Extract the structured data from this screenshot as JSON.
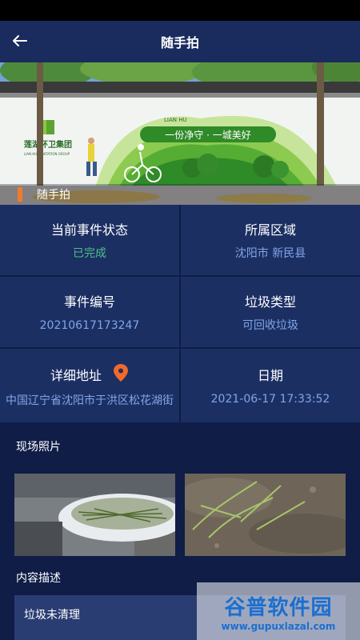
{
  "header": {
    "title": "随手拍"
  },
  "banner": {
    "slogan": "一份净守 · 一城美好",
    "company": "莲湖环卫集团",
    "company_en": "LIAN HU SANITATION GROUP",
    "tag": "LIAN HU",
    "section_label": "随手拍"
  },
  "info": {
    "status_label": "当前事件状态",
    "status_value": "已完成",
    "region_label": "所属区域",
    "region_value": "沈阳市 新民县",
    "event_no_label": "事件编号",
    "event_no_value": "20210617173247",
    "garbage_type_label": "垃圾类型",
    "garbage_type_value": "可回收垃圾",
    "address_label": "详细地址",
    "address_value": "中国辽宁省沈阳市于洪区松花湖街",
    "date_label": "日期",
    "date_value": "2021-06-17 17:33:52"
  },
  "photos": {
    "section_title": "现场照片"
  },
  "description": {
    "section_title": "内容描述",
    "text": "垃圾未清理"
  },
  "watermark": {
    "line1": "谷普软件园",
    "line2": "www.gupuxlazal.com"
  }
}
